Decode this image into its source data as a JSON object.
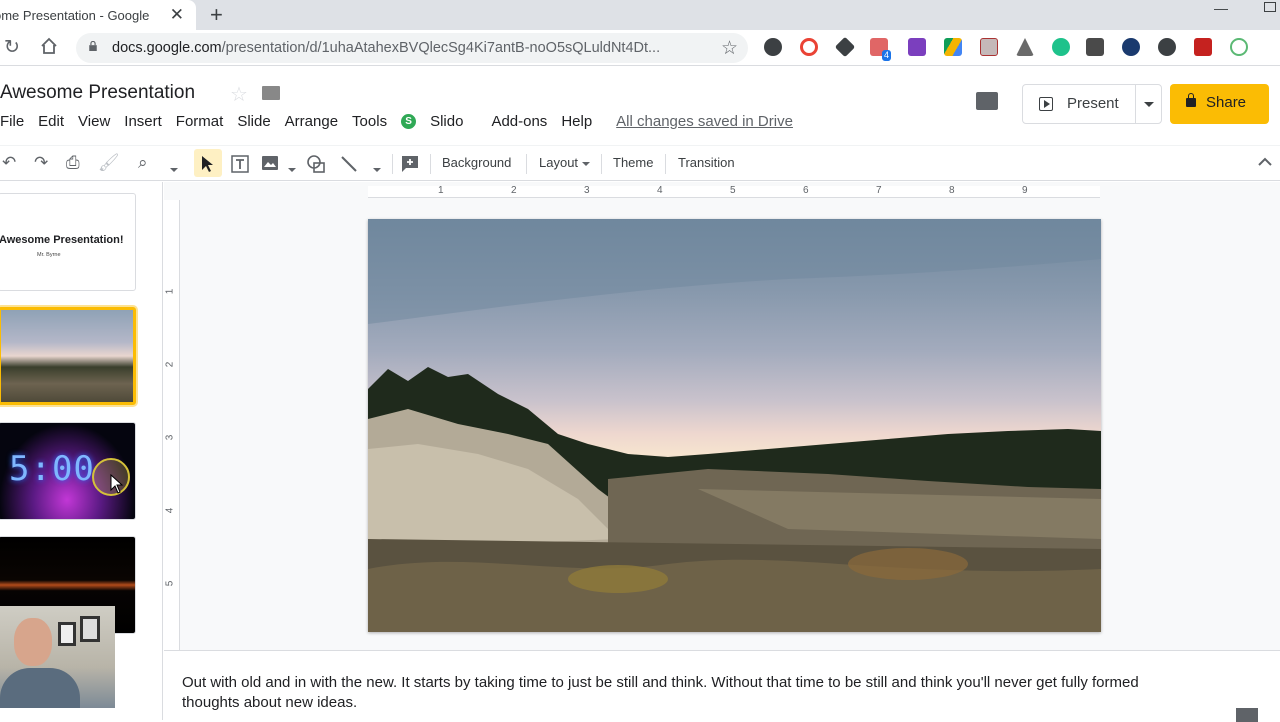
{
  "browser": {
    "tab_title": "ome Presentation - Google",
    "url_host": "docs.google.com",
    "url_path": "/presentation/d/1uhaAtahexBVQlecSg4Ki7antB-noO5sQLuldNt4Dt...",
    "extension_badge": "4"
  },
  "doc": {
    "title": "Awesome Presentation",
    "menu": [
      "File",
      "Edit",
      "View",
      "Insert",
      "Format",
      "Slide",
      "Arrange",
      "Tools",
      "Slido",
      "Add-ons",
      "Help"
    ],
    "saved_status": "All changes saved in Drive",
    "present_label": "Present",
    "share_label": "Share"
  },
  "toolbar": {
    "background_label": "Background",
    "layout_label": "Layout",
    "theme_label": "Theme",
    "transition_label": "Transition"
  },
  "filmstrip": {
    "slide1_title": "Awesome Presentation!",
    "slide1_subtitle": "Mr. Byrne",
    "slide3_timer": "5:00",
    "selected_index": 2
  },
  "rulers": {
    "horizontal": [
      "1",
      "2",
      "3",
      "4",
      "5",
      "6",
      "7",
      "8",
      "9"
    ],
    "vertical": [
      "1",
      "2",
      "3",
      "4",
      "5"
    ]
  },
  "notes": {
    "text": "Out with old and in with the new. It starts by taking time to just be still and think. Without that time to be still and think you'll never get fully formed thoughts about new ideas."
  },
  "colors": {
    "accent": "#fbbc04",
    "slido_green": "#30a956",
    "selected_tool_bg": "#fef0c3"
  }
}
